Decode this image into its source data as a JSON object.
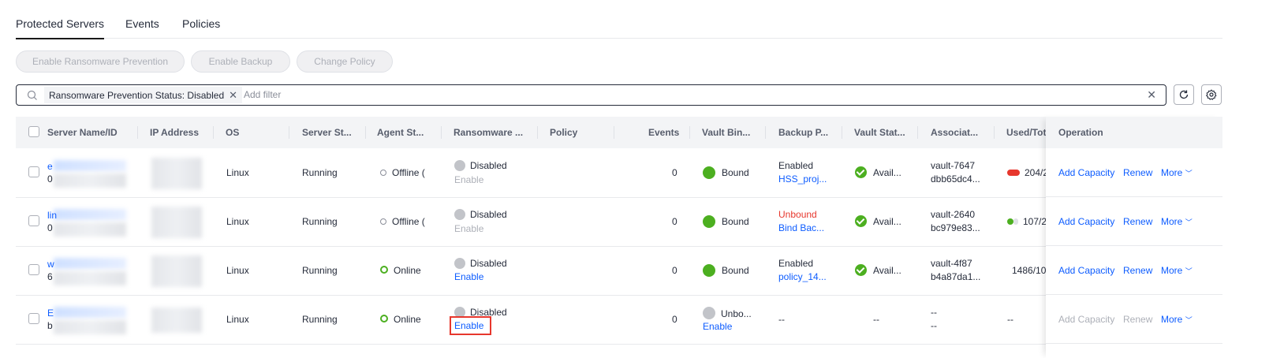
{
  "tabs": [
    "Protected Servers",
    "Events",
    "Policies"
  ],
  "actions": {
    "enable_ransomware": "Enable Ransomware Prevention",
    "enable_backup": "Enable Backup",
    "change_policy": "Change Policy"
  },
  "search": {
    "chip": "Ransomware Prevention Status: Disabled",
    "placeholder": "Add filter"
  },
  "columns": [
    "Server Name/ID",
    "IP Address",
    "OS",
    "Server St...",
    "Agent St...",
    "Ransomware ...",
    "Policy",
    "Events",
    "Vault Bin...",
    "Backup P...",
    "Vault Stat...",
    "Associat...",
    "Used/Tot.",
    "Operation"
  ],
  "rows": [
    {
      "name": "e",
      "id": "0",
      "os": "Linux",
      "server_status": "Running",
      "agent_status": "Offline (",
      "ransomware": "Disabled",
      "ransomware_action": "Enable",
      "events": "0",
      "vault_binding": "Bound",
      "backup_policy_status": "Enabled",
      "backup_policy": "HSS_proj...",
      "vault_status": "Avail...",
      "vault_name": "vault-7647",
      "vault_id": "dbb65dc4...",
      "used": "204/2",
      "op1": "Add Capacity",
      "op2": "Renew",
      "op3": "More"
    },
    {
      "name": "lin",
      "id": "0",
      "os": "Linux",
      "server_status": "Running",
      "agent_status": "Offline (",
      "ransomware": "Disabled",
      "ransomware_action": "Enable",
      "events": "0",
      "vault_binding": "Bound",
      "backup_policy_status": "Unbound",
      "backup_policy": "Bind Bac...",
      "vault_status": "Avail...",
      "vault_name": "vault-2640",
      "vault_id": "bc979e83...",
      "used": "107/2",
      "op1": "Add Capacity",
      "op2": "Renew",
      "op3": "More"
    },
    {
      "name": "w",
      "id": "6",
      "os": "Linux",
      "server_status": "Running",
      "agent_status": "Online",
      "ransomware": "Disabled",
      "ransomware_action": "Enable",
      "events": "0",
      "vault_binding": "Bound",
      "backup_policy_status": "Enabled",
      "backup_policy": "policy_14...",
      "vault_status": "Avail...",
      "vault_name": "vault-4f87",
      "vault_id": "b4a87da1...",
      "used": "1486/10",
      "op1": "Add Capacity",
      "op2": "Renew",
      "op3": "More"
    },
    {
      "name": "E",
      "id": "b",
      "os": "Linux",
      "server_status": "Running",
      "agent_status": "Online",
      "ransomware": "Disabled",
      "ransomware_action": "Enable",
      "events": "0",
      "vault_binding": "Unbo...",
      "vault_binding_action": "Enable",
      "backup_policy_status": "--",
      "vault_status": "--",
      "vault_name": "--",
      "vault_id": "--",
      "used": "--",
      "op1": "Add Capacity",
      "op2": "Renew",
      "op3": "More"
    }
  ]
}
